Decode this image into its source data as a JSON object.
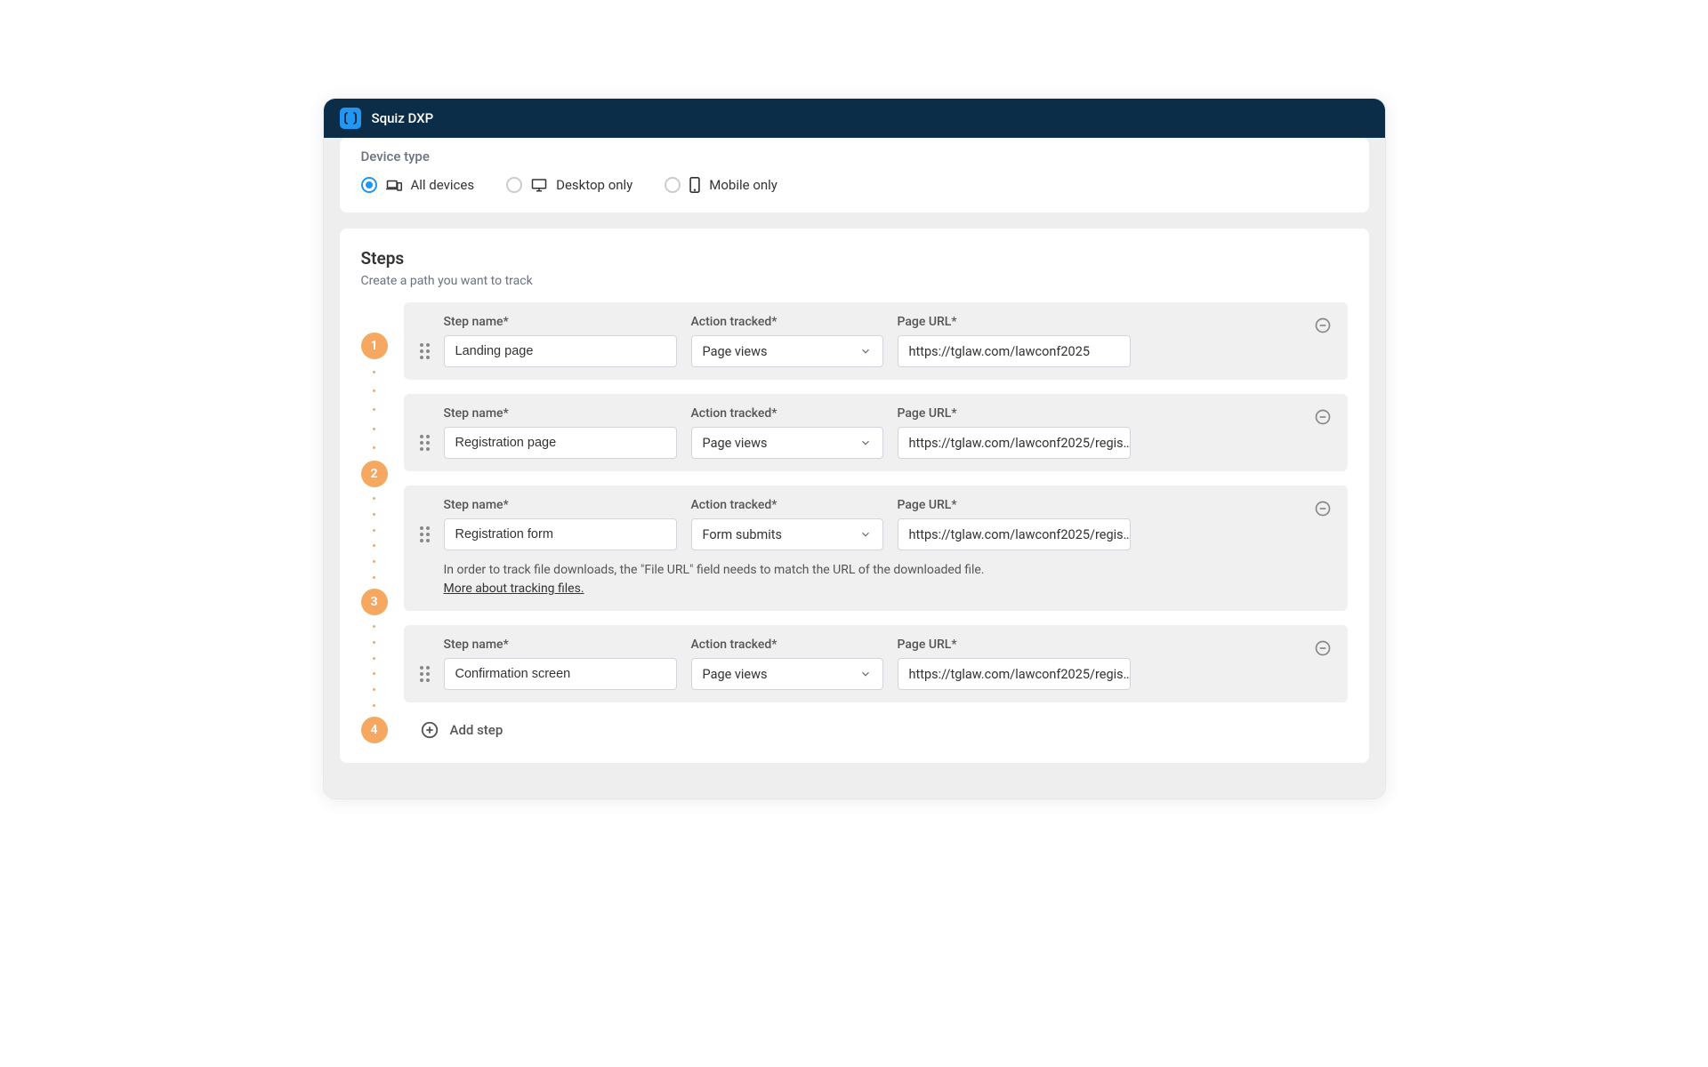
{
  "header": {
    "title": "Squiz DXP"
  },
  "device": {
    "label": "Device type",
    "options": [
      {
        "label": "All devices",
        "checked": true
      },
      {
        "label": "Desktop only",
        "checked": false
      },
      {
        "label": "Mobile only",
        "checked": false
      }
    ]
  },
  "steps": {
    "title": "Steps",
    "subtitle": "Create a path you want to track",
    "labels": {
      "step_name": "Step name*",
      "action_tracked": "Action tracked*",
      "page_url": "Page URL*"
    },
    "items": [
      {
        "num": "1",
        "name": "Landing page",
        "action": "Page views",
        "url": "https://tglaw.com/lawconf2025"
      },
      {
        "num": "2",
        "name": "Registration page",
        "action": "Page views",
        "url": "https://tglaw.com/lawconf2025/regis…"
      },
      {
        "num": "3",
        "name": "Registration form",
        "action": "Form submits",
        "url": "https://tglaw.com/lawconf2025/regis…",
        "hint_text": "In order to track file downloads, the \"File URL\" field needs to match the URL of the downloaded file.",
        "hint_link": "More about tracking files."
      },
      {
        "num": "4",
        "name": "Confirmation screen",
        "action": "Page views",
        "url": "https://tglaw.com/lawconf2025/regis…"
      }
    ],
    "add_label": "Add step"
  }
}
